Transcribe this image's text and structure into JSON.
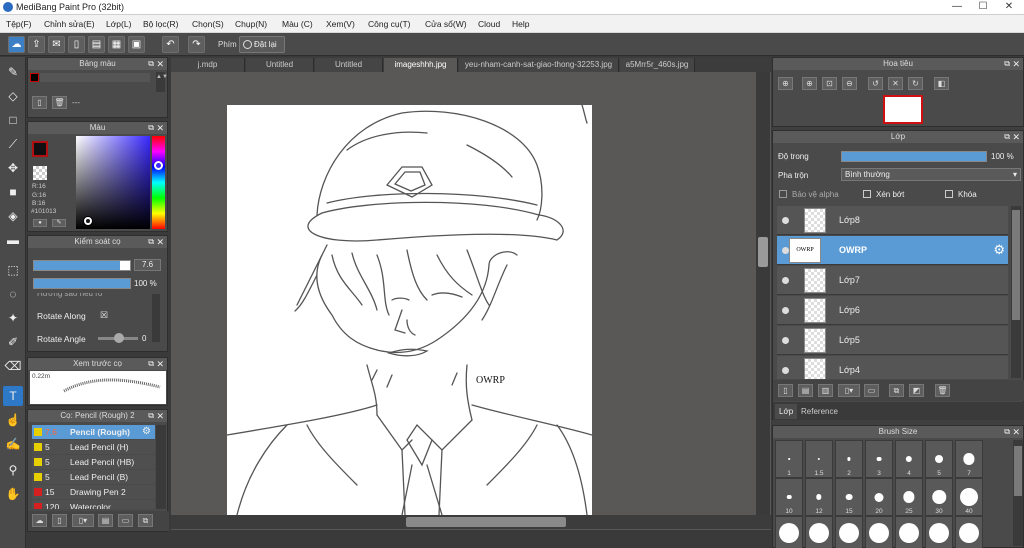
{
  "window": {
    "title": "MediBang Paint Pro (32bit)",
    "controls": [
      "—",
      "☐",
      "✕"
    ]
  },
  "menu": [
    "Tệp(F)",
    "Chỉnh sửa(E)",
    "Lớp(L)",
    "Bộ lọc(R)",
    "Chọn(S)",
    "Chụp(N)",
    "Màu (C)",
    "Xem(V)",
    "Công cụ(T)",
    "Cửa sổ(W)",
    "Cloud",
    "Help"
  ],
  "toolbar": {
    "phim_label": "Phím",
    "reset_label": "Đặt lại"
  },
  "tabs": [
    "j.mdp",
    "Untitled",
    "Untitled",
    "imageshhh.jpg",
    "yeu-nham-canh-sat-giao-thong-32253.jpg",
    "a5Mrr5r_460s.jpg"
  ],
  "active_tab_index": 3,
  "palette_panel": {
    "title": "Bảng màu",
    "dash": "---"
  },
  "color_panel": {
    "title": "Màu",
    "r": "R:16",
    "g": "G:16",
    "b": "B:16",
    "hex": "#101013"
  },
  "brush_control": {
    "title": "Kiểm soát cọ",
    "size": "7.6",
    "opacity": "100 %",
    "partial": "Hướng sào nếu rõ",
    "rotate_along": "Rotate Along",
    "rotate_along_mark": "☒",
    "rotate_angle": "Rotate Angle",
    "angle_value": "0",
    "size_fill": 0.9,
    "opacity_fill": 1.0
  },
  "brush_preview": {
    "title": "Xem trước cọ",
    "size_label": "0.22m"
  },
  "brush_list": {
    "title": "Cọ: Pencil (Rough) 2",
    "items": [
      {
        "size": "7.6",
        "name": "Pencil (Rough)",
        "color": "#e8d000",
        "active": true
      },
      {
        "size": "5",
        "name": "Lead Pencil (H)",
        "color": "#e8d000",
        "active": false
      },
      {
        "size": "5",
        "name": "Lead Pencil (HB)",
        "color": "#e8d000",
        "active": false
      },
      {
        "size": "5",
        "name": "Lead Pencil (B)",
        "color": "#e8d000",
        "active": false
      },
      {
        "size": "15",
        "name": "Drawing Pen 2",
        "color": "#d42020",
        "active": false
      },
      {
        "size": "120",
        "name": "Watercolor",
        "color": "#d42020",
        "active": false
      }
    ]
  },
  "navigator": {
    "title": "Hoa tiêu"
  },
  "layer_panel": {
    "title": "Lớp",
    "opacity_label": "Độ trong",
    "opacity_value": "100 %",
    "opacity_fill": 1.0,
    "blend_label": "Pha trộn",
    "blend_value": "Bình thường",
    "protect_alpha": "Bảo vệ alpha",
    "clipping": "Xén bớt",
    "lock": "Khóa",
    "layers": [
      {
        "name": "Lớp8",
        "active": false,
        "thumb": ""
      },
      {
        "name": "OWRP",
        "active": true,
        "thumb": "OWRP"
      },
      {
        "name": "Lớp7",
        "active": false,
        "thumb": ""
      },
      {
        "name": "Lớp6",
        "active": false,
        "thumb": ""
      },
      {
        "name": "Lớp5",
        "active": false,
        "thumb": ""
      },
      {
        "name": "Lớp4",
        "active": false,
        "thumb": ""
      }
    ],
    "tabs": [
      "Lớp",
      "Reference"
    ]
  },
  "brush_size": {
    "title": "Brush Size",
    "row1": [
      "1",
      "1.5",
      "2",
      "3",
      "4",
      "5",
      "7"
    ],
    "row2": [
      "10",
      "12",
      "15",
      "20",
      "25",
      "30",
      "40"
    ]
  },
  "canvas": {
    "text": "OWRP"
  },
  "colors": {
    "accent": "#5b9bd5",
    "panel": "#4a4a4a",
    "canvas_bg": "#5a5757"
  }
}
